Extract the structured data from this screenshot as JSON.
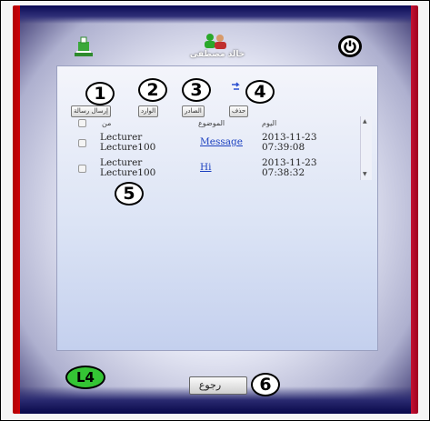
{
  "header": {
    "user_name": "خالد مصطفى"
  },
  "toolbar": {
    "tabs": [
      {
        "label": "إرسال رسالة"
      },
      {
        "label": "الوارد"
      },
      {
        "label": "الصادر"
      },
      {
        "label": "حذف"
      }
    ]
  },
  "table": {
    "columns": [
      "من",
      "الموضوع",
      "اليوم"
    ],
    "rows": [
      {
        "sender_line1": "Lecturer",
        "sender_line2": "Lecture100",
        "subject": "Message",
        "date": "2013-11-23",
        "time": "07:39:08"
      },
      {
        "sender_line1": "Lecturer",
        "sender_line2": "Lecture100",
        "subject": "Hi",
        "date": "2013-11-23",
        "time": "07:38:32"
      }
    ]
  },
  "callouts": [
    "1",
    "2",
    "3",
    "4",
    "5",
    "6"
  ],
  "footer": {
    "level_badge": "L4",
    "back_label": "رجوع"
  },
  "colors": {
    "badge_green": "#34c534",
    "link_blue": "#1a3fbf",
    "frame_red": "#e00010",
    "frame_navy": "#0a0a55"
  },
  "icons": [
    "university-logo-icon",
    "users-icon",
    "power-icon",
    "scroll-up-icon",
    "scroll-down-icon",
    "blue-hint-icon"
  ]
}
